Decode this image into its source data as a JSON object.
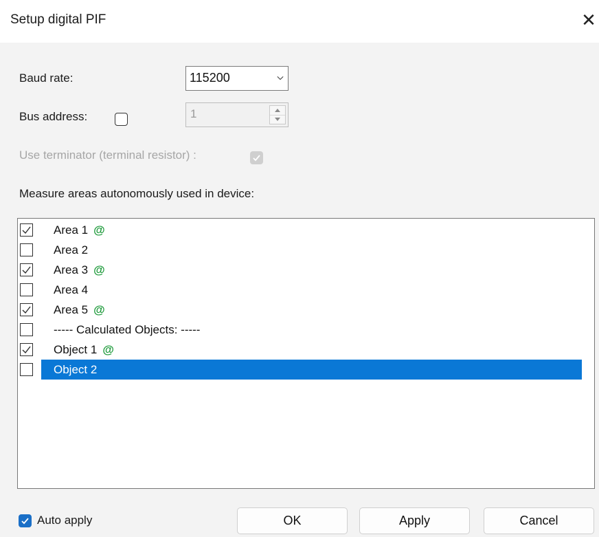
{
  "window": {
    "title": "Setup digital PIF",
    "close_glyph": "✕"
  },
  "baud_rate": {
    "label": "Baud rate:",
    "value": "115200"
  },
  "bus_address": {
    "label": "Bus address:",
    "checked": false,
    "value": "1"
  },
  "terminator": {
    "label": "Use terminator (terminal resistor) :",
    "checked": true,
    "enabled": false
  },
  "areas_heading": "Measure areas autonomously used in device:",
  "areas": {
    "items": [
      {
        "label": "Area 1",
        "checked": true,
        "marker": "@"
      },
      {
        "label": "Area 2",
        "checked": false,
        "marker": ""
      },
      {
        "label": "Area 3",
        "checked": true,
        "marker": "@"
      },
      {
        "label": "Area 4",
        "checked": false,
        "marker": ""
      },
      {
        "label": "Area 5",
        "checked": true,
        "marker": "@"
      },
      {
        "label": "----- Calculated Objects: -----",
        "checked": false,
        "marker": ""
      },
      {
        "label": "Object 1",
        "checked": true,
        "marker": "@"
      },
      {
        "label": "Object 2",
        "checked": false,
        "marker": "",
        "selected": true
      }
    ]
  },
  "footer": {
    "auto_apply_label": "Auto apply",
    "auto_apply_checked": true,
    "ok_label": "OK",
    "apply_label": "Apply",
    "cancel_label": "Cancel"
  },
  "colors": {
    "accent": "#0a78d6",
    "marker": "#1d9a3a"
  }
}
